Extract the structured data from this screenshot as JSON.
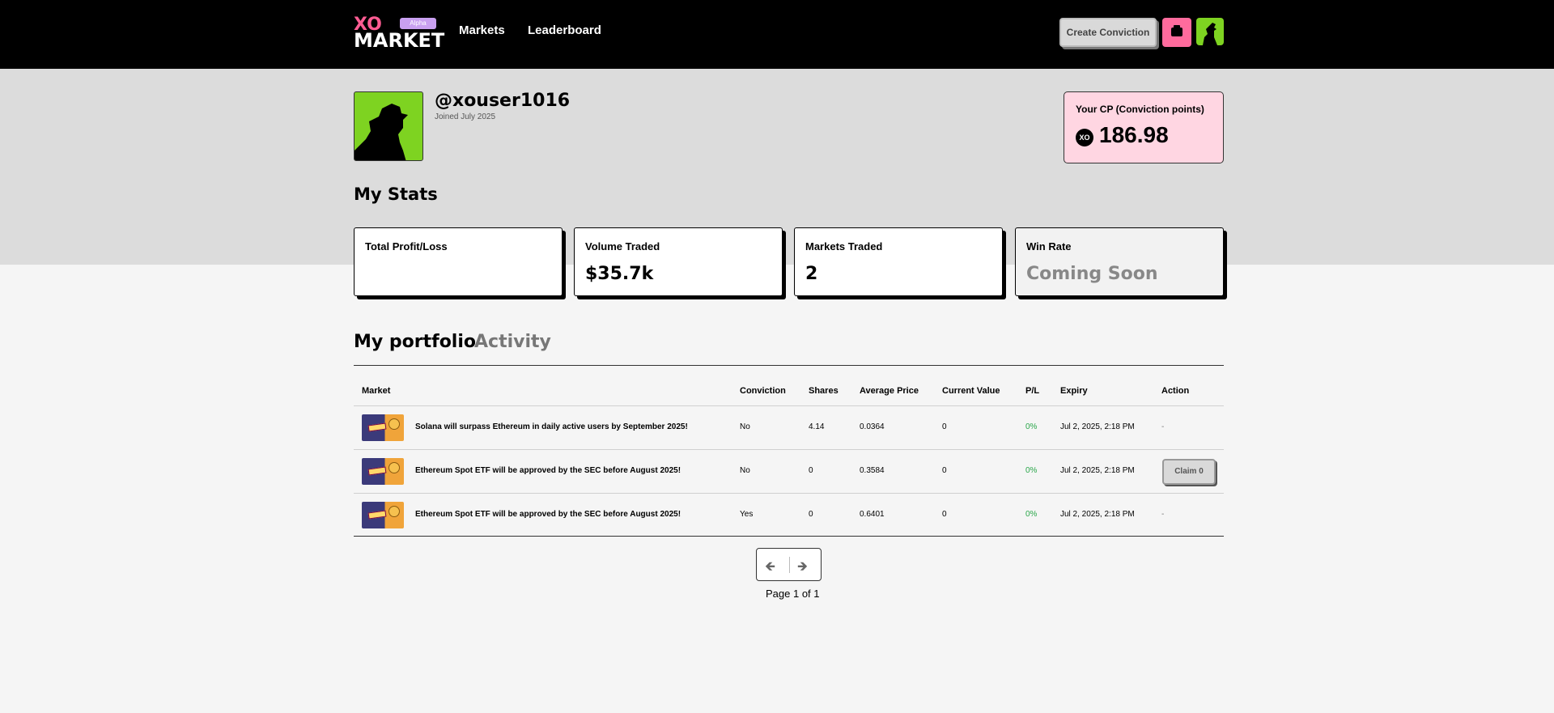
{
  "header": {
    "logo_top": "XO",
    "logo_bottom": "MARKET",
    "alpha_badge": "Alpha",
    "nav": [
      "Markets",
      "Leaderboard"
    ],
    "create_button": "Create Conviction",
    "wallet_icon": "wallet-icon",
    "avatar_icon": "avatar-icon"
  },
  "profile": {
    "username": "@xouser1016",
    "joined": "Joined July 2025",
    "cp_label": "Your CP (Conviction points)",
    "cp_badge": "XO",
    "cp_value": "186.98"
  },
  "stats": {
    "title": "My Stats",
    "cards": [
      {
        "label": "Total Profit/Loss",
        "value": ""
      },
      {
        "label": "Volume Traded",
        "value": "$35.7k"
      },
      {
        "label": "Markets Traded",
        "value": "2"
      },
      {
        "label": "Win Rate",
        "value": "Coming Soon"
      }
    ]
  },
  "tabs": [
    "My portfolio",
    "Activity"
  ],
  "table": {
    "headers": [
      "Market",
      "Conviction",
      "Shares",
      "Average Price",
      "Current Value",
      "P/L",
      "Expiry",
      "Action"
    ],
    "rows": [
      {
        "market": "Solana will surpass Ethereum in daily active users by September 2025!",
        "conviction": "No",
        "shares": "4.14",
        "avg_price": "0.0364",
        "current_value": "0",
        "pl": "0%",
        "expiry": "Jul 2, 2025, 2:18 PM",
        "action": "-"
      },
      {
        "market": "Ethereum Spot ETF will be approved by the SEC before August 2025!",
        "conviction": "No",
        "shares": "0",
        "avg_price": "0.3584",
        "current_value": "0",
        "pl": "0%",
        "expiry": "Jul 2, 2025, 2:18 PM",
        "action": "Claim 0"
      },
      {
        "market": "Ethereum Spot ETF will be approved by the SEC before August 2025!",
        "conviction": "Yes",
        "shares": "0",
        "avg_price": "0.6401",
        "current_value": "0",
        "pl": "0%",
        "expiry": "Jul 2, 2025, 2:18 PM",
        "action": "-"
      }
    ]
  },
  "pagination": {
    "prev": "🡸",
    "next": "🡺",
    "info": "Page 1 of 1"
  },
  "colors": {
    "accent_pink": "#ff6b9d",
    "avatar_green": "#7ed321",
    "positive": "#2aa64a"
  }
}
